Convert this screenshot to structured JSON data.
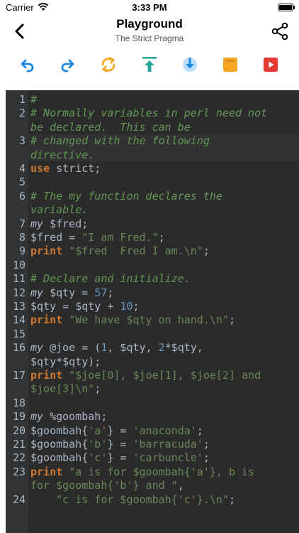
{
  "status": {
    "carrier": "Carrier",
    "time": "3:33 PM"
  },
  "nav": {
    "title": "Playground",
    "subtitle": "The Strict Pragma"
  },
  "toolbar": {
    "icons": [
      "undo-icon",
      "redo-icon",
      "refresh-icon",
      "scroll-to-top-icon",
      "download-icon",
      "note-icon",
      "run-icon"
    ],
    "colors": {
      "blue": "#1e88e5",
      "orange": "#f5a623",
      "teal": "#26a69a",
      "red": "#e53935"
    }
  },
  "editor": {
    "background": "#2b2b2b",
    "lines": [
      {
        "num": "1",
        "segs": [
          {
            "t": "#",
            "c": "c-comment"
          }
        ]
      },
      {
        "num": "2",
        "segs": [
          {
            "t": "# Normally variables in perl need not",
            "c": "c-comment"
          }
        ]
      },
      {
        "num": "",
        "segs": [
          {
            "t": "be declared.  This can be",
            "c": "c-comment"
          }
        ]
      },
      {
        "num": "3",
        "segs": [
          {
            "t": "# changed with the following",
            "c": "c-comment"
          }
        ]
      },
      {
        "num": "",
        "segs": [
          {
            "t": "directive.",
            "c": "c-comment"
          }
        ]
      },
      {
        "num": "4",
        "segs": [
          {
            "t": "use",
            "c": "c-kw"
          },
          {
            "t": " strict;",
            "c": "c-plain"
          }
        ]
      },
      {
        "num": "5",
        "segs": []
      },
      {
        "num": "6",
        "segs": [
          {
            "t": "# The my function declares the",
            "c": "c-comment"
          }
        ]
      },
      {
        "num": "",
        "segs": [
          {
            "t": "variable.",
            "c": "c-comment"
          }
        ]
      },
      {
        "num": "7",
        "segs": [
          {
            "t": "my",
            "c": "c-my"
          },
          {
            "t": " $fred;",
            "c": "c-plain"
          }
        ]
      },
      {
        "num": "8",
        "segs": [
          {
            "t": "$fred = ",
            "c": "c-plain"
          },
          {
            "t": "\"I am Fred.\"",
            "c": "c-str"
          },
          {
            "t": ";",
            "c": "c-plain"
          }
        ]
      },
      {
        "num": "9",
        "segs": [
          {
            "t": "print",
            "c": "c-kw"
          },
          {
            "t": " ",
            "c": "c-plain"
          },
          {
            "t": "\"$fred  Fred I am.\\n\"",
            "c": "c-str"
          },
          {
            "t": ";",
            "c": "c-plain"
          }
        ]
      },
      {
        "num": "10",
        "segs": []
      },
      {
        "num": "11",
        "segs": [
          {
            "t": "# Declare and initialize.",
            "c": "c-comment"
          }
        ]
      },
      {
        "num": "12",
        "segs": [
          {
            "t": "my",
            "c": "c-my"
          },
          {
            "t": " $qty = ",
            "c": "c-plain"
          },
          {
            "t": "57",
            "c": "c-num"
          },
          {
            "t": ";",
            "c": "c-plain"
          }
        ]
      },
      {
        "num": "13",
        "segs": [
          {
            "t": "$qty = $qty + ",
            "c": "c-plain"
          },
          {
            "t": "10",
            "c": "c-num"
          },
          {
            "t": ";",
            "c": "c-plain"
          }
        ]
      },
      {
        "num": "14",
        "segs": [
          {
            "t": "print",
            "c": "c-kw"
          },
          {
            "t": " ",
            "c": "c-plain"
          },
          {
            "t": "\"We have $qty on hand.\\n\"",
            "c": "c-str"
          },
          {
            "t": ";",
            "c": "c-plain"
          }
        ]
      },
      {
        "num": "15",
        "segs": []
      },
      {
        "num": "16",
        "segs": [
          {
            "t": "my",
            "c": "c-my"
          },
          {
            "t": " @joe = (",
            "c": "c-plain"
          },
          {
            "t": "1",
            "c": "c-num"
          },
          {
            "t": ", $qty, ",
            "c": "c-plain"
          },
          {
            "t": "2",
            "c": "c-num"
          },
          {
            "t": "*$qty,",
            "c": "c-plain"
          }
        ]
      },
      {
        "num": "",
        "segs": [
          {
            "t": "$qty*$qty);",
            "c": "c-plain"
          }
        ]
      },
      {
        "num": "17",
        "segs": [
          {
            "t": "print",
            "c": "c-kw"
          },
          {
            "t": " ",
            "c": "c-plain"
          },
          {
            "t": "\"$joe[0], $joe[1], $joe[2] and",
            "c": "c-str"
          }
        ]
      },
      {
        "num": "",
        "segs": [
          {
            "t": "$joe[3]\\n\"",
            "c": "c-str"
          },
          {
            "t": ";",
            "c": "c-plain"
          }
        ]
      },
      {
        "num": "18",
        "segs": []
      },
      {
        "num": "19",
        "segs": [
          {
            "t": "my",
            "c": "c-my"
          },
          {
            "t": " %goombah;",
            "c": "c-plain"
          }
        ]
      },
      {
        "num": "20",
        "segs": [
          {
            "t": "$goombah{",
            "c": "c-plain"
          },
          {
            "t": "'a'",
            "c": "c-str"
          },
          {
            "t": "} = ",
            "c": "c-plain"
          },
          {
            "t": "'anaconda'",
            "c": "c-str"
          },
          {
            "t": ";",
            "c": "c-plain"
          }
        ]
      },
      {
        "num": "21",
        "segs": [
          {
            "t": "$goombah{",
            "c": "c-plain"
          },
          {
            "t": "'b'",
            "c": "c-str"
          },
          {
            "t": "} = ",
            "c": "c-plain"
          },
          {
            "t": "'barracuda'",
            "c": "c-str"
          },
          {
            "t": ";",
            "c": "c-plain"
          }
        ]
      },
      {
        "num": "22",
        "segs": [
          {
            "t": "$goombah{",
            "c": "c-plain"
          },
          {
            "t": "'c'",
            "c": "c-str"
          },
          {
            "t": "} = ",
            "c": "c-plain"
          },
          {
            "t": "'carbuncle'",
            "c": "c-str"
          },
          {
            "t": ";",
            "c": "c-plain"
          }
        ]
      },
      {
        "num": "23",
        "segs": [
          {
            "t": "print",
            "c": "c-kw"
          },
          {
            "t": " ",
            "c": "c-plain"
          },
          {
            "t": "\"a is for $goombah{'a'}, b is",
            "c": "c-str"
          }
        ]
      },
      {
        "num": "",
        "segs": [
          {
            "t": "for $goombah{'b'} and \"",
            "c": "c-str"
          },
          {
            "t": ",",
            "c": "c-plain"
          }
        ]
      },
      {
        "num": "24",
        "segs": [
          {
            "t": "    ",
            "c": "c-plain"
          },
          {
            "t": "\"c is for $goombah{'c'}.\\n\"",
            "c": "c-str"
          },
          {
            "t": ";",
            "c": "c-plain"
          }
        ]
      }
    ]
  }
}
